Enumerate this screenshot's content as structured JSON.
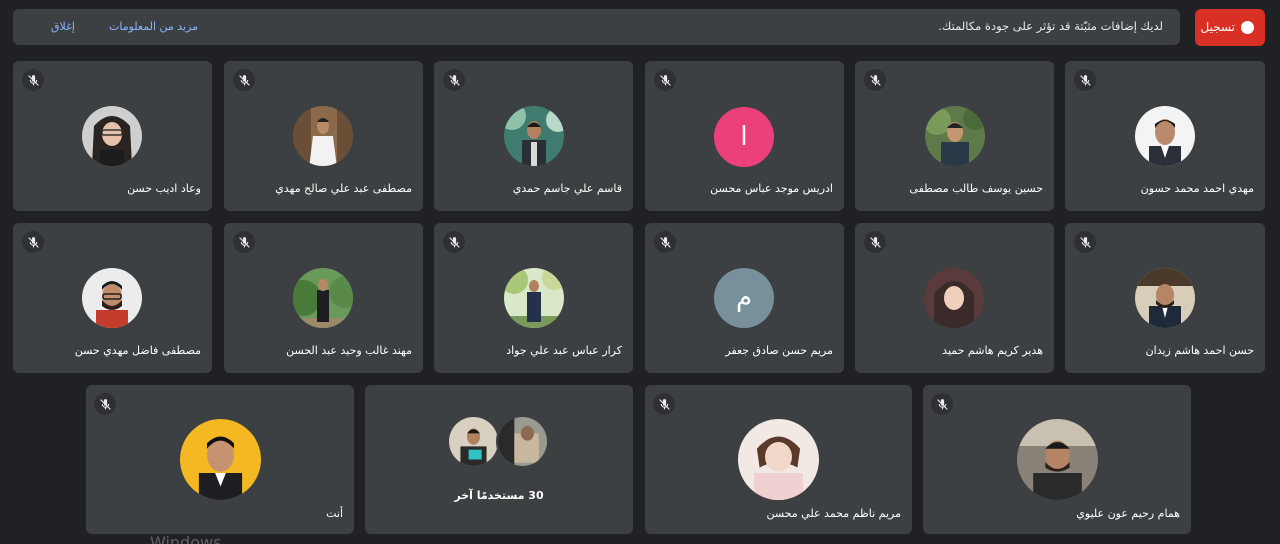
{
  "notice": {
    "message": "لديك إضافات مثبّتة قد تؤثر على جودة مكالمتك.",
    "more_info": "مزيد من المعلومات",
    "dismiss": "إغلاق"
  },
  "record_button": {
    "label": "تسجيل"
  },
  "participants": {
    "row1": [
      {
        "name": "مهدي احمد محمد حسون",
        "avatar": "photo-man-suit"
      },
      {
        "name": "حسين يوسف طالب مصطفى",
        "avatar": "photo-man-trees"
      },
      {
        "name": "ادريس موجد عباس محسن",
        "avatar": "letter",
        "letter": "ا",
        "color": "#ec407a"
      },
      {
        "name": "قاسم علي جاسم حمدي",
        "avatar": "photo-man-greenery"
      },
      {
        "name": "مصطفى عبد علي صالح مهدي",
        "avatar": "photo-man-white-robe"
      },
      {
        "name": "وعاد اديب حسن",
        "avatar": "photo-woman-glasses"
      }
    ],
    "row2": [
      {
        "name": "حسن احمد هاشم زيدان",
        "avatar": "photo-man-office"
      },
      {
        "name": "هدير كريم هاشم حميد",
        "avatar": "photo-woman-hijab"
      },
      {
        "name": "مريم حسن صادق جعفر",
        "avatar": "letter",
        "letter": "م",
        "color": "#78909c"
      },
      {
        "name": "كرار عباس عبد علي جواد",
        "avatar": "photo-man-outdoor"
      },
      {
        "name": "مهند غالب وحيد عبد الحسن",
        "avatar": "photo-man-garden"
      },
      {
        "name": "مصطفى فاضل مهدي حسن",
        "avatar": "photo-man-beard-glasses"
      }
    ],
    "row3": [
      {
        "name": "همام رحيم عون عليوي",
        "avatar": "photo-man-car"
      },
      {
        "name": "مريم ناظم محمد علي محسن",
        "avatar": "photo-baby"
      },
      {
        "name": "30 مستخدمًا آخر",
        "avatar": "group"
      },
      {
        "name": "أنت",
        "avatar": "photo-man-yellow"
      }
    ]
  },
  "watermark": "Windows",
  "colors": {
    "background": "#202124",
    "tile": "#3c4043",
    "record": "#d93025",
    "link": "#8ab4f8"
  }
}
